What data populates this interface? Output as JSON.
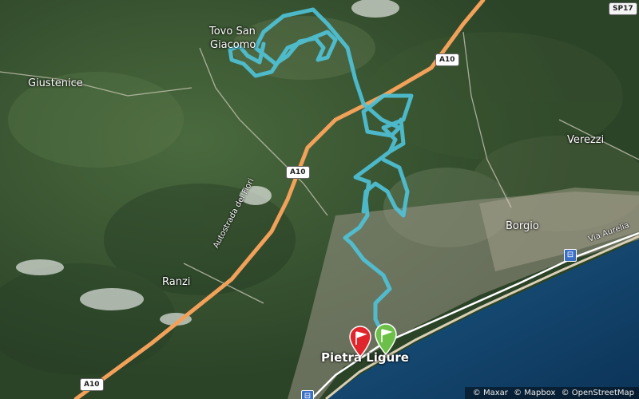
{
  "places": {
    "tovo": "Tovo San\nGiacomo",
    "tovo_line1": "Tovo San",
    "tovo_line2": "Giacomo",
    "giustenice": "Giustenice",
    "verezzi": "Verezzi",
    "borgio": "Borgio",
    "ranzi": "Ranzi",
    "pietra": "Pietra Ligure"
  },
  "roads": {
    "sp17": "SP17",
    "a10_top": "A10",
    "a10_mid": "A10",
    "a10_bottom": "A10",
    "autostrada": "Autostrada dei Fiori",
    "aurelia": "Via Aurelia"
  },
  "attribution": {
    "maxar": "© Maxar",
    "mapbox": "© Mapbox",
    "osm": "© OpenStreetMap"
  },
  "markers": {
    "start_icon": "green-flag-pin",
    "finish_icon": "red-flag-pin",
    "rail_icon": "train-station-icon"
  },
  "colors": {
    "route": "#4fc3d9",
    "highway": "#f2a15a",
    "sea": "#14466e",
    "start": "#6cc04a",
    "finish": "#e0262c"
  }
}
